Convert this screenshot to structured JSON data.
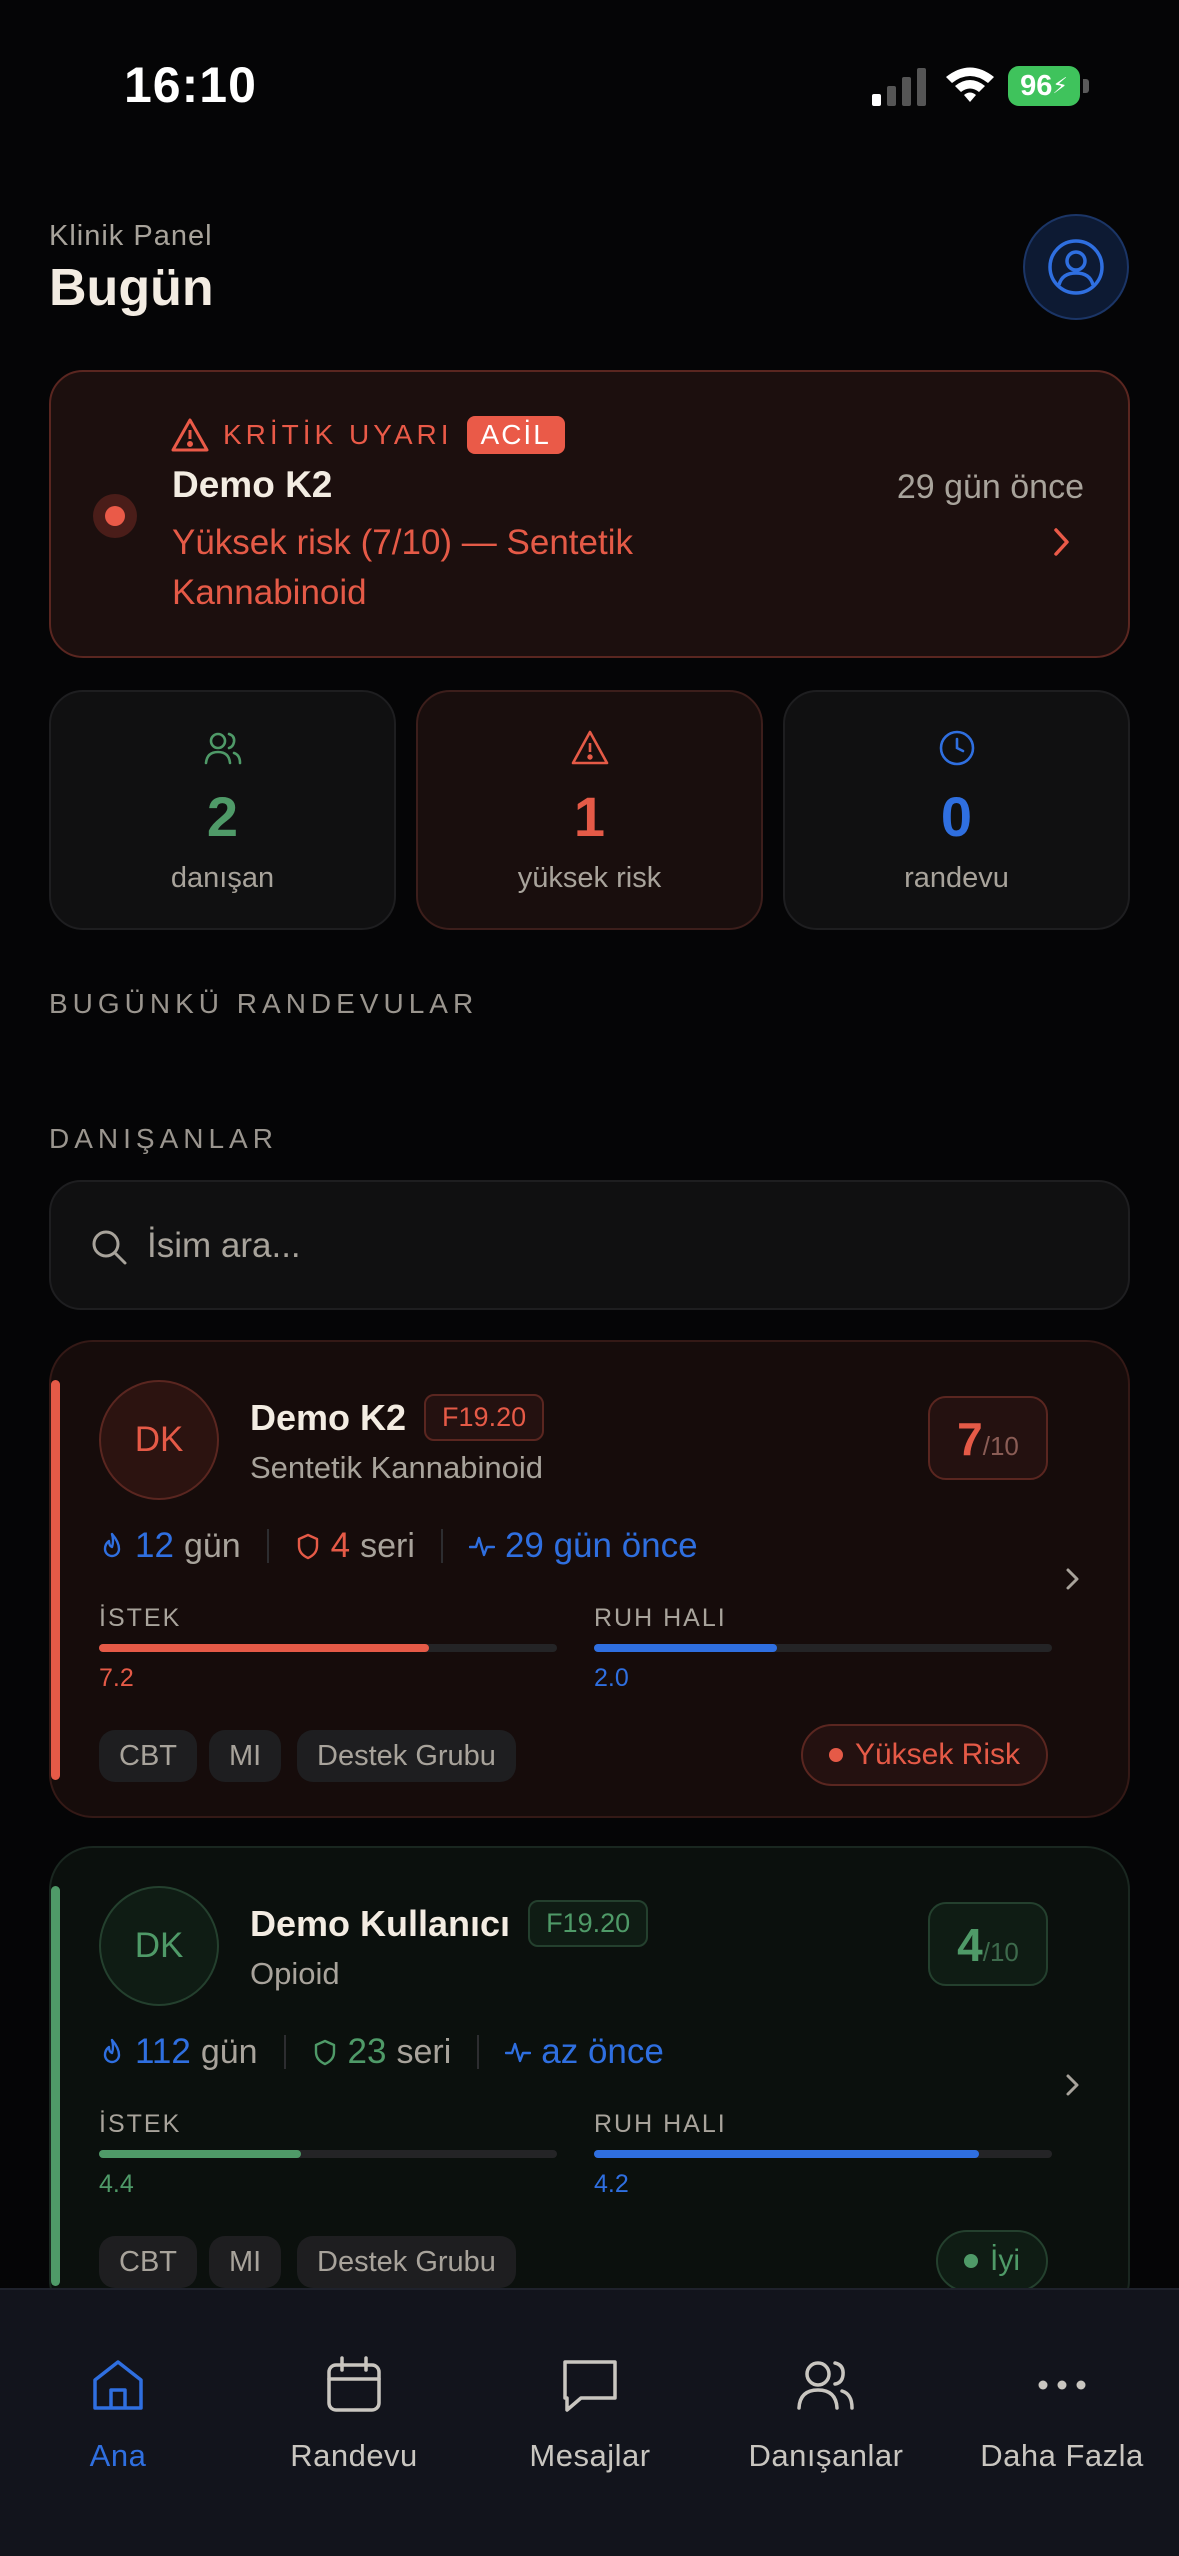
{
  "status_bar": {
    "time": "16:10",
    "battery": "96"
  },
  "header": {
    "subtitle": "Klinik Panel",
    "title": "Bugün"
  },
  "alert": {
    "kicker": "KRİTİK UYARI",
    "badge": "ACİL",
    "name": "Demo K2",
    "description": "Yüksek risk (7/10) — Sentetik Kannabinoid",
    "time": "29 gün önce"
  },
  "stats": [
    {
      "value": "2",
      "label": "danışan",
      "color": "#4f9a68"
    },
    {
      "value": "1",
      "label": "yüksek risk",
      "color": "#e55a47"
    },
    {
      "value": "0",
      "label": "randevu",
      "color": "#2f6fe0"
    }
  ],
  "sections": {
    "appointments": "BUGÜNKÜ RANDEVULAR",
    "clients": "DANIŞANLAR"
  },
  "search": {
    "placeholder": "İsim ara..."
  },
  "clients": [
    {
      "initials": "DK",
      "name": "Demo K2",
      "code": "F19.20",
      "substance": "Sentetik Kannabinoid",
      "score": "7",
      "score_max": "/10",
      "days": "12",
      "days_unit": "gün",
      "streak": "4",
      "streak_unit": "seri",
      "last_seen": "29 gün önce",
      "craving_label": "İSTEK",
      "craving_value": "7.2",
      "craving_fraction": 0.72,
      "mood_label": "RUH HALI",
      "mood_value": "2.0",
      "mood_fraction": 0.4,
      "tags": [
        "CBT",
        "MI",
        "Destek Grubu"
      ],
      "status": "Yüksek Risk",
      "accent": "#e55a47"
    },
    {
      "initials": "DK",
      "name": "Demo Kullanıcı",
      "code": "F19.20",
      "substance": "Opioid",
      "score": "4",
      "score_max": "/10",
      "days": "112",
      "days_unit": "gün",
      "streak": "23",
      "streak_unit": "seri",
      "last_seen": "az önce",
      "craving_label": "İSTEK",
      "craving_value": "4.4",
      "craving_fraction": 0.44,
      "mood_label": "RUH HALI",
      "mood_value": "4.2",
      "mood_fraction": 0.84,
      "tags": [
        "CBT",
        "MI",
        "Destek Grubu"
      ],
      "status": "İyi",
      "accent": "#4f9a68"
    }
  ],
  "tabs": [
    {
      "label": "Ana",
      "icon": "home-icon",
      "active": true
    },
    {
      "label": "Randevu",
      "icon": "calendar-icon",
      "active": false
    },
    {
      "label": "Mesajlar",
      "icon": "message-icon",
      "active": false
    },
    {
      "label": "Danışanlar",
      "icon": "users-icon",
      "active": false
    },
    {
      "label": "Daha Fazla",
      "icon": "more-icon",
      "active": false
    }
  ],
  "colors": {
    "accent_blue": "#2f6fe0",
    "risk_red": "#e55a47",
    "good_green": "#4f9a68",
    "background": "#050506"
  }
}
